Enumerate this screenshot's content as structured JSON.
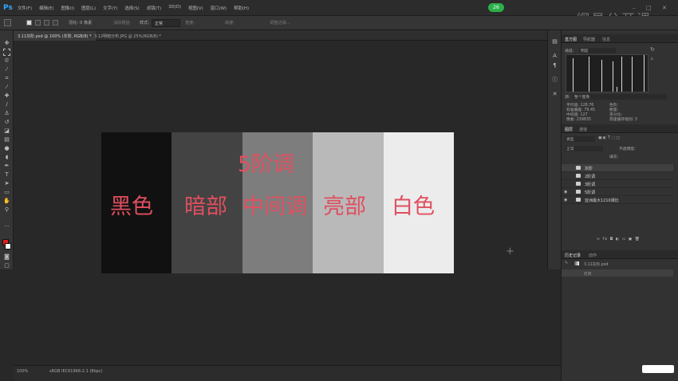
{
  "menubar": {
    "app_logo": "Ps",
    "items": [
      "文件(F)",
      "编辑(E)",
      "图像(I)",
      "图层(L)",
      "文字(Y)",
      "选择(S)",
      "滤镜(T)",
      "3D(D)",
      "视图(V)",
      "窗口(W)",
      "帮助(H)"
    ],
    "badge": "26",
    "watermark": "網易公开课"
  },
  "options": {
    "feather_label": "羽化:",
    "feather_value": "0 像素",
    "antialias": "消除锯齿",
    "style_label": "样式:",
    "style_value": "正常",
    "width_label": "宽度:",
    "height_label": "高度:",
    "refine": "调整边缘..."
  },
  "tabs": [
    {
      "label": "3.11灰阶.psd @ 100% (灰阶, RGB/8) *"
    },
    {
      "label": "3.12明暗分布.JPG @ 25%(RGB/8) *"
    }
  ],
  "artwork": {
    "title": "5阶调",
    "bands": [
      {
        "label": "黑色",
        "color": "#111111"
      },
      {
        "label": "暗部",
        "color": "#434343"
      },
      {
        "label": "中间调",
        "color": "#7d7d7d"
      },
      {
        "label": "亮部",
        "color": "#b9b9b9"
      },
      {
        "label": "白色",
        "color": "#ececec"
      }
    ],
    "label_color": "#e04f5f"
  },
  "status": {
    "zoom": "100%",
    "doc": "sRGB IEC61966-2.1 (8bpc)"
  },
  "histogram_panel": {
    "tabs": [
      "直方图",
      "导航器",
      "信息"
    ],
    "channel_label": "通道:",
    "channel_value": "明度",
    "source_label": "源:",
    "source_value": "整个图像",
    "stats": [
      {
        "k": "平均值:",
        "v": "128.76"
      },
      {
        "k": "标准偏差:",
        "v": "79.45"
      },
      {
        "k": "中间值:",
        "v": "127"
      },
      {
        "k": "像素:",
        "v": "239835"
      }
    ],
    "stats_right": [
      "色阶:",
      "数量:",
      "百分位:",
      "高速缓存级别: 3"
    ]
  },
  "layers_panel": {
    "tabs": [
      "图层",
      "通道"
    ],
    "kind_label": "类型",
    "blend": "正常",
    "opacity_label": "不透明度:",
    "fill_label": "填充:",
    "layers": [
      {
        "name": "灰阶",
        "visible": false,
        "selected": true
      },
      {
        "name": "2阶调",
        "visible": false,
        "selected": false
      },
      {
        "name": "3阶调",
        "visible": false,
        "selected": false
      },
      {
        "name": "5阶调",
        "visible": true,
        "selected": false
      },
      {
        "name": "亚洲最大1210课比",
        "visible": true,
        "selected": false
      }
    ]
  },
  "history_panel": {
    "tabs": [
      "历史记录",
      "动作"
    ],
    "items": [
      "3.11灰阶.psd",
      "打开"
    ]
  }
}
